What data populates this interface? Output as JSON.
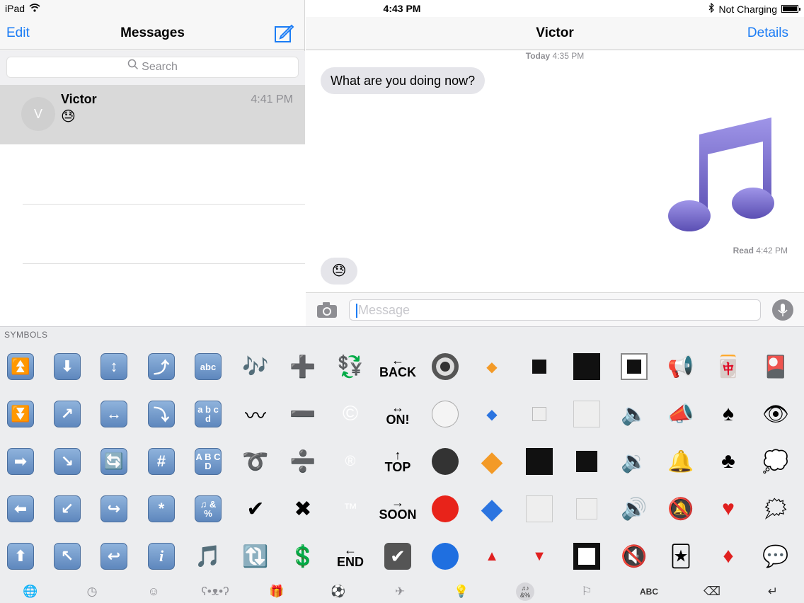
{
  "status": {
    "device": "iPad",
    "time": "4:43 PM",
    "battery_text": "Not Charging"
  },
  "left": {
    "edit_label": "Edit",
    "title": "Messages",
    "search_placeholder": "Search",
    "conversation": {
      "avatar_initial": "V",
      "name": "Victor",
      "time": "4:41 PM",
      "preview": "😓"
    }
  },
  "right": {
    "title": "Victor",
    "details_label": "Details",
    "timestamp_bold": "Today",
    "timestamp_time": "4:35 PM",
    "incoming_message": "What are you doing now?",
    "read_bold": "Read",
    "read_time": "4:42 PM",
    "incoming_emoji": "😓",
    "message_placeholder": "Message"
  },
  "keyboard": {
    "category_label": "SYMBOLS",
    "abc_label": "ABC",
    "keys": {
      "back": "BACK",
      "on": "ON!",
      "top": "TOP",
      "soon": "SOON",
      "end": "END",
      "abc": "abc",
      "abcd": "a b c d",
      "ABCD": "A B C D",
      "sym": "♫ & %"
    }
  },
  "colors": {
    "accent": "#1b7cf5",
    "bubble_gray": "#e5e5ea",
    "keyboard_bg": "#ecedef"
  }
}
